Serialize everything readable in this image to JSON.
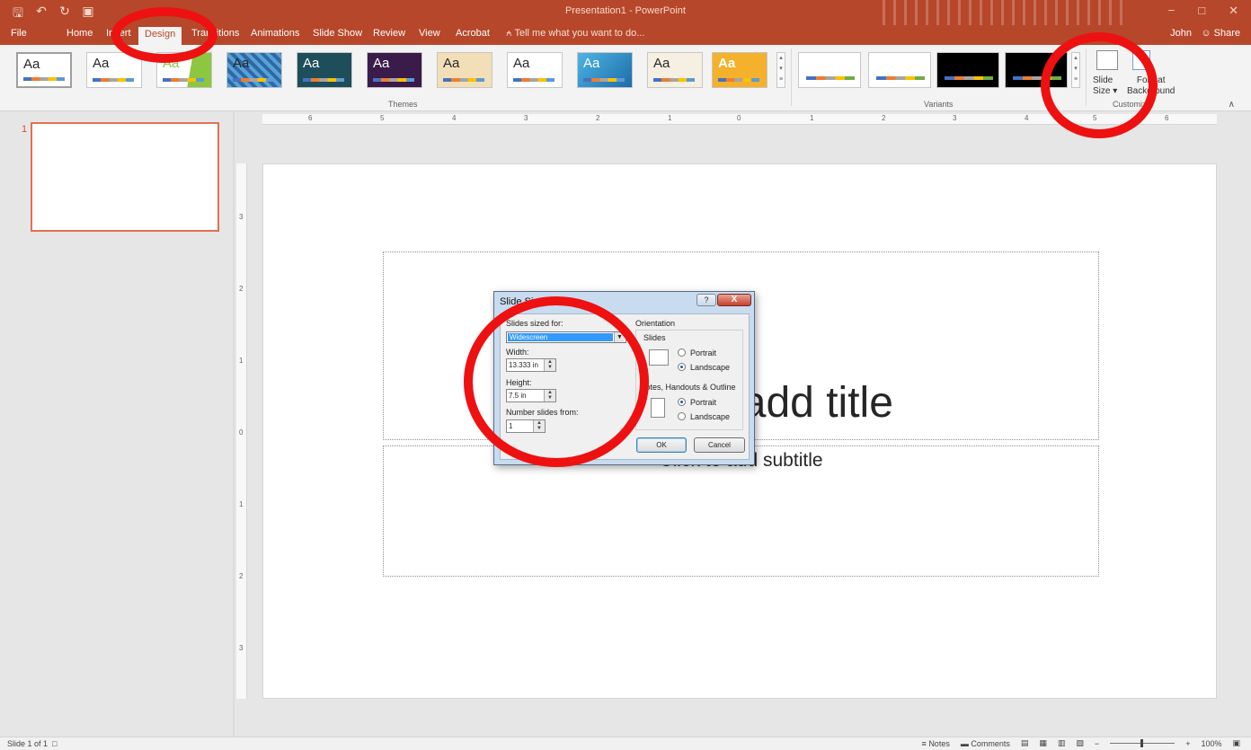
{
  "app": {
    "document_title": "Presentation1 - PowerPoint",
    "user_name": "John",
    "share_label": "Share",
    "tell_me": "Tell me what you want to do..."
  },
  "tabs": [
    "File",
    "Home",
    "Insert",
    "Design",
    "Transitions",
    "Animations",
    "Slide Show",
    "Review",
    "View",
    "Acrobat"
  ],
  "active_tab": "Design",
  "ribbon": {
    "themes_label": "Themes",
    "variants_label": "Variants",
    "customize_label": "Customize",
    "theme_sample": "Aa",
    "slide_size_label_1": "Slide",
    "slide_size_label_2": "Size",
    "format_bg_label_1": "Format",
    "format_bg_label_2": "Background"
  },
  "thumbnail": {
    "number": "1"
  },
  "slide": {
    "title_placeholder": "Click to add title",
    "subtitle_placeholder": "Click to add subtitle"
  },
  "ruler": {
    "horizontal": [
      "6",
      "5",
      "4",
      "3",
      "2",
      "1",
      "0",
      "1",
      "2",
      "3",
      "4",
      "5",
      "6"
    ],
    "vertical": [
      "3",
      "2",
      "1",
      "0",
      "1",
      "2",
      "3"
    ]
  },
  "dialog": {
    "title": "Slide Size",
    "help": "?",
    "close": "X",
    "sized_for_label": "Slides sized for:",
    "sized_for_value": "Widescreen",
    "width_label": "Width:",
    "width_value": "13.333 in",
    "height_label": "Height:",
    "height_value": "7.5 in",
    "number_from_label": "Number slides from:",
    "number_from_value": "1",
    "orientation_label": "Orientation",
    "slides_label": "Slides",
    "portrait": "Portrait",
    "landscape": "Landscape",
    "notes_label": "Notes, Handouts & Outline",
    "ok": "OK",
    "cancel": "Cancel"
  },
  "status": {
    "slide_of": "Slide 1 of 1",
    "notes": "Notes",
    "comments": "Comments",
    "zoom": "100%"
  },
  "colors": {
    "accent": "#b7472a",
    "annotation": "#ee1111",
    "selection_border": "#e27055"
  },
  "icons": [
    "save-icon",
    "undo-icon",
    "redo-icon",
    "present-icon",
    "lightbulb-icon",
    "person-icon",
    "fit-slide-icon"
  ]
}
